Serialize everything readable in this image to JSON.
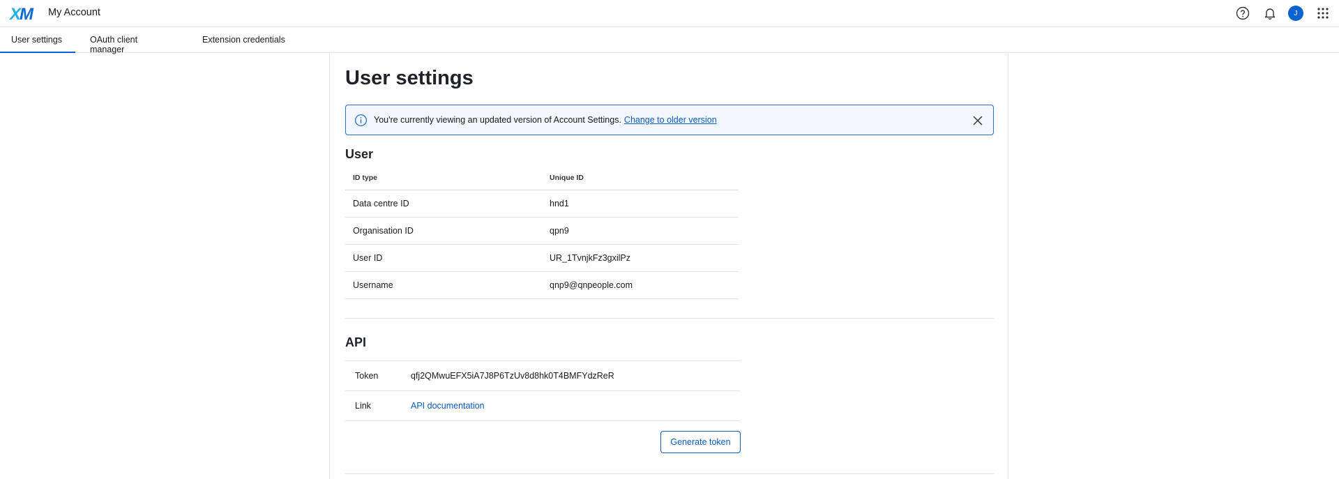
{
  "header": {
    "logo_x": "X",
    "logo_m": "M",
    "app_title": "My Account",
    "avatar_initial": "J",
    "icons": [
      "help-icon",
      "bell-icon",
      "avatar",
      "app-grid-icon"
    ]
  },
  "tabs": [
    {
      "label": "User settings",
      "active": true
    },
    {
      "label": "OAuth client manager",
      "active": false
    },
    {
      "label": "Extension credentials",
      "active": false
    }
  ],
  "page": {
    "title": "User settings"
  },
  "banner": {
    "message": "You're currently viewing an updated version of Account Settings.",
    "link": "Change to older version"
  },
  "user": {
    "heading": "User",
    "columns": [
      "ID type",
      "Unique ID"
    ],
    "rows": [
      {
        "type": "Data centre ID",
        "value": "hnd1"
      },
      {
        "type": "Organisation ID",
        "value": "qpn9"
      },
      {
        "type": "User ID",
        "value": "UR_1TvnjkFz3gxilPz"
      },
      {
        "type": "Username",
        "value": "qnp9@qnpeople.com"
      }
    ]
  },
  "api": {
    "heading": "API",
    "token_label": "Token",
    "token_value": "qfj2QMwuEFX5iA7J8P6TzUv8d8hk0T4BMFYdzReR",
    "link_label": "Link",
    "link_text": "API documentation",
    "generate_button": "Generate token"
  },
  "colors": {
    "accent": "#0b63d1",
    "link": "#0b5bbf",
    "banner_border": "#2a6fd0",
    "banner_bg": "#f2f7fd",
    "logo_x": "#1fb0e8",
    "logo_m": "#0a6bd6"
  }
}
